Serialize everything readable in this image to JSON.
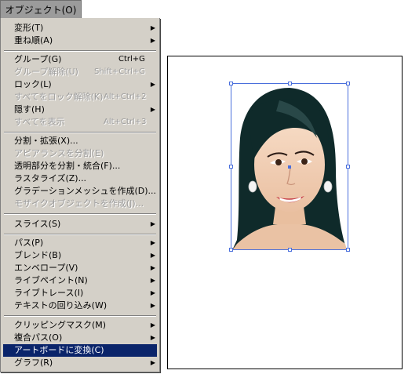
{
  "menubar": {
    "title": "オブジェクト(O)"
  },
  "menu": {
    "items": [
      {
        "label": "変形(T)",
        "shortcut": "",
        "arrow": "▶"
      },
      {
        "label": "重ね順(A)",
        "shortcut": "",
        "arrow": "▶"
      },
      {
        "label": "グループ(G)",
        "shortcut": "Ctrl+G",
        "arrow": ""
      },
      {
        "label": "グループ解除(U)",
        "shortcut": "Shift+Ctrl+G",
        "arrow": ""
      },
      {
        "label": "ロック(L)",
        "shortcut": "",
        "arrow": "▶"
      },
      {
        "label": "すべてをロック解除(K)",
        "shortcut": "Alt+Ctrl+2",
        "arrow": ""
      },
      {
        "label": "隠す(H)",
        "shortcut": "",
        "arrow": "▶"
      },
      {
        "label": "すべてを表示",
        "shortcut": "Alt+Ctrl+3",
        "arrow": ""
      },
      {
        "label": "分割・拡張(X)...",
        "shortcut": "",
        "arrow": ""
      },
      {
        "label": "アピアランスを分割(E)",
        "shortcut": "",
        "arrow": ""
      },
      {
        "label": "透明部分を分割・統合(F)...",
        "shortcut": "",
        "arrow": ""
      },
      {
        "label": "ラスタライズ(Z)...",
        "shortcut": "",
        "arrow": ""
      },
      {
        "label": "グラデーションメッシュを作成(D)...",
        "shortcut": "",
        "arrow": ""
      },
      {
        "label": "モザイクオブジェクトを作成(J)...",
        "shortcut": "",
        "arrow": ""
      },
      {
        "label": "スライス(S)",
        "shortcut": "",
        "arrow": "▶"
      },
      {
        "label": "パス(P)",
        "shortcut": "",
        "arrow": "▶"
      },
      {
        "label": "ブレンド(B)",
        "shortcut": "",
        "arrow": "▶"
      },
      {
        "label": "エンベロープ(V)",
        "shortcut": "",
        "arrow": "▶"
      },
      {
        "label": "ライブペイント(N)",
        "shortcut": "",
        "arrow": "▶"
      },
      {
        "label": "ライブトレース(I)",
        "shortcut": "",
        "arrow": "▶"
      },
      {
        "label": "テキストの回り込み(W)",
        "shortcut": "",
        "arrow": "▶"
      },
      {
        "label": "クリッピングマスク(M)",
        "shortcut": "",
        "arrow": "▶"
      },
      {
        "label": "複合パス(O)",
        "shortcut": "",
        "arrow": "▶"
      },
      {
        "label": "アートボードに変換(C)",
        "shortcut": "",
        "arrow": ""
      },
      {
        "label": "グラフ(R)",
        "shortcut": "",
        "arrow": "▶"
      }
    ]
  },
  "colors": {
    "menu_bg": "#d4d0c8",
    "highlight": "#0a246a",
    "disabled_text": "#9c9c9c",
    "selection": "#4a6fdc",
    "hair": "#0f2a2a"
  }
}
